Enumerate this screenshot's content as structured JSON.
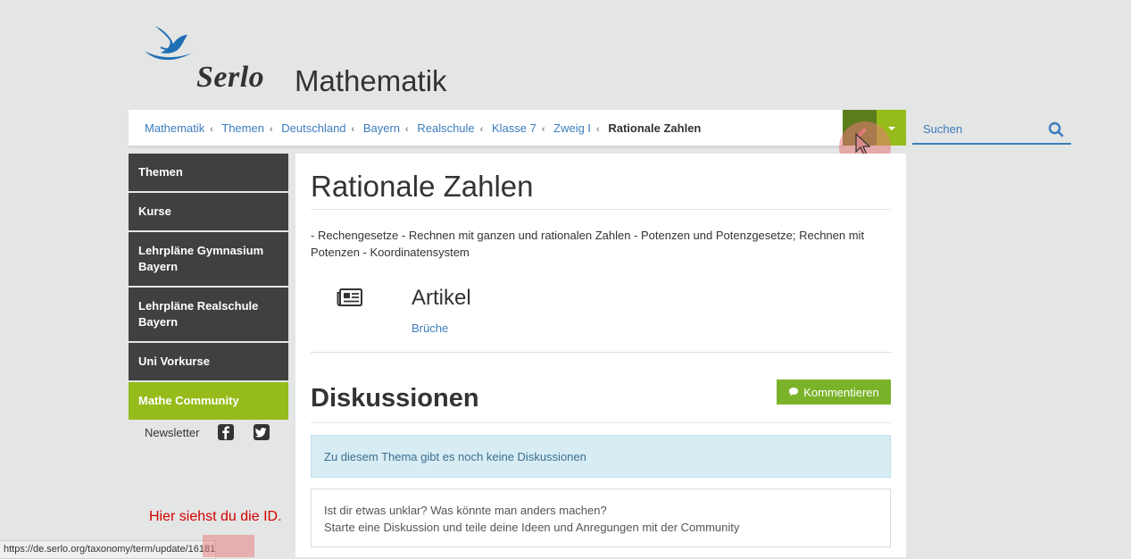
{
  "brand": {
    "name": "Serlo",
    "subject": "Mathematik"
  },
  "breadcrumb": [
    {
      "label": "Mathematik"
    },
    {
      "label": "Themen"
    },
    {
      "label": "Deutschland"
    },
    {
      "label": "Bayern"
    },
    {
      "label": "Realschule"
    },
    {
      "label": "Klasse 7"
    },
    {
      "label": "Zweig I"
    }
  ],
  "breadcrumb_current": "Rationale Zahlen",
  "search": {
    "placeholder": "Suchen"
  },
  "sidebar": {
    "items": [
      {
        "label": "Themen"
      },
      {
        "label": "Kurse"
      },
      {
        "label": "Lehrpläne Gymnasium Bayern"
      },
      {
        "label": "Lehrpläne Realschule Bayern"
      },
      {
        "label": "Uni Vorkurse"
      },
      {
        "label": "Mathe Community"
      }
    ],
    "newsletter": "Newsletter"
  },
  "main": {
    "title": "Rationale Zahlen",
    "description": "- Rechengesetze - Rechnen mit ganzen und rationalen Zahlen - Potenzen und Potenzgesetze; Rechnen mit Potenzen - Koordinatensystem",
    "article_heading": "Artikel",
    "article_link": "Brüche",
    "discussions_heading": "Diskussionen",
    "comment_button": "Kommentieren",
    "no_discussions": "Zu diesem Thema gibt es noch keine Diskussionen",
    "prompt_line1": "Ist dir etwas unklar? Was könnte man anders machen?",
    "prompt_line2": "Starte eine Diskussion und teile deine Ideen und Anregungen mit der Community"
  },
  "annotation": "Hier siehst du die ID.",
  "status_url": "https://de.serlo.org/taxonomy/term/update/16181",
  "colors": {
    "accent_green": "#95bc1a",
    "link_blue": "#3b7dbc",
    "sidebar_dark": "#404040"
  }
}
